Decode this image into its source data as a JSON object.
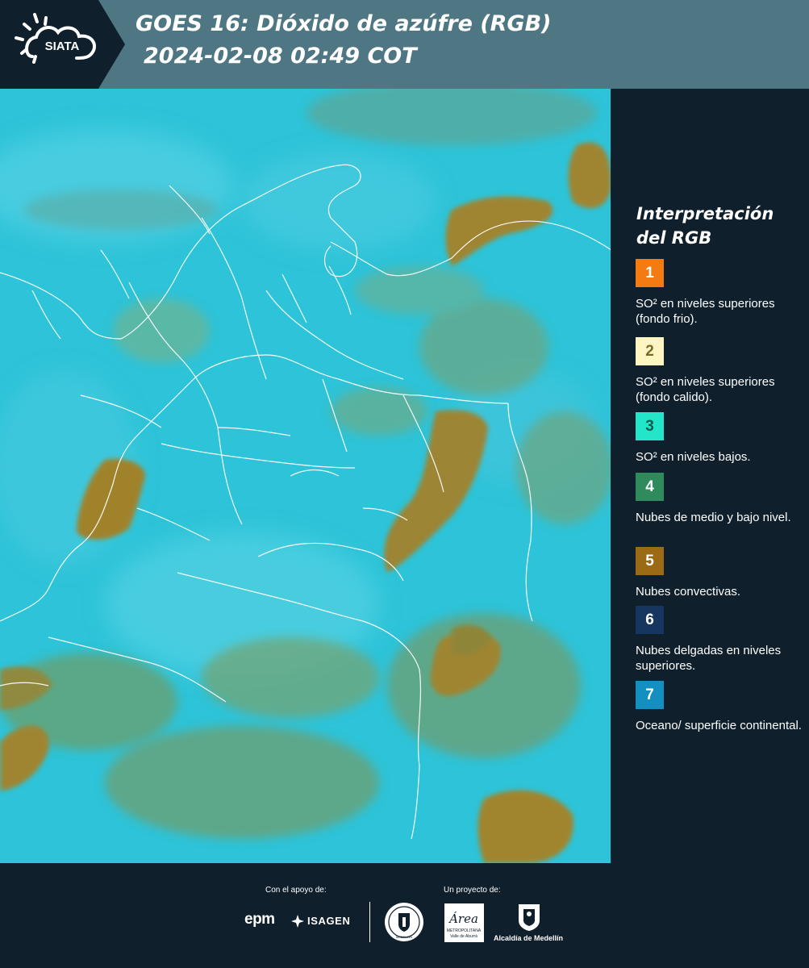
{
  "header": {
    "logo_text": "SIATA",
    "title_line1": "GOES 16: Dióxido de azúfre (RGB)",
    "title_line2": "2024-02-08 02:49 COT"
  },
  "legend": {
    "title_line1": "Interpretación",
    "title_line2": "del RGB",
    "items": [
      {
        "number": "1",
        "color": "#f47a12",
        "label": "SO² en niveles superiores (fondo frio)."
      },
      {
        "number": "2",
        "color": "#fdf6c3",
        "label": "SO² en niveles superiores (fondo calido)."
      },
      {
        "number": "3",
        "color": "#22e6c7",
        "label": "SO² en niveles bajos."
      },
      {
        "number": "4",
        "color": "#2f8a5c",
        "label": "Nubes de medio y bajo nivel."
      },
      {
        "number": "5",
        "color": "#9a6a14",
        "label": "Nubes convectivas."
      },
      {
        "number": "6",
        "color": "#17365f",
        "label": "Nubes delgadas en niveles superiores."
      },
      {
        "number": "7",
        "color": "#1390c0",
        "label": "Oceano/ superficie continental."
      }
    ]
  },
  "footer": {
    "support_label": "Con el apoyo de:",
    "project_label": "Un proyecto de:",
    "epm": "epm",
    "isagen": "ISAGEN",
    "seal_text": "MEDELLÍN",
    "area_text": "Área",
    "area_sub1": "METROPOLITANA",
    "area_sub2": "Valle de Aburrá",
    "alcaldia": "Alcaldía de Medellín"
  },
  "icons": {
    "logo": "siata-sun-cloud-logo",
    "map": "satellite-rgb-map"
  }
}
